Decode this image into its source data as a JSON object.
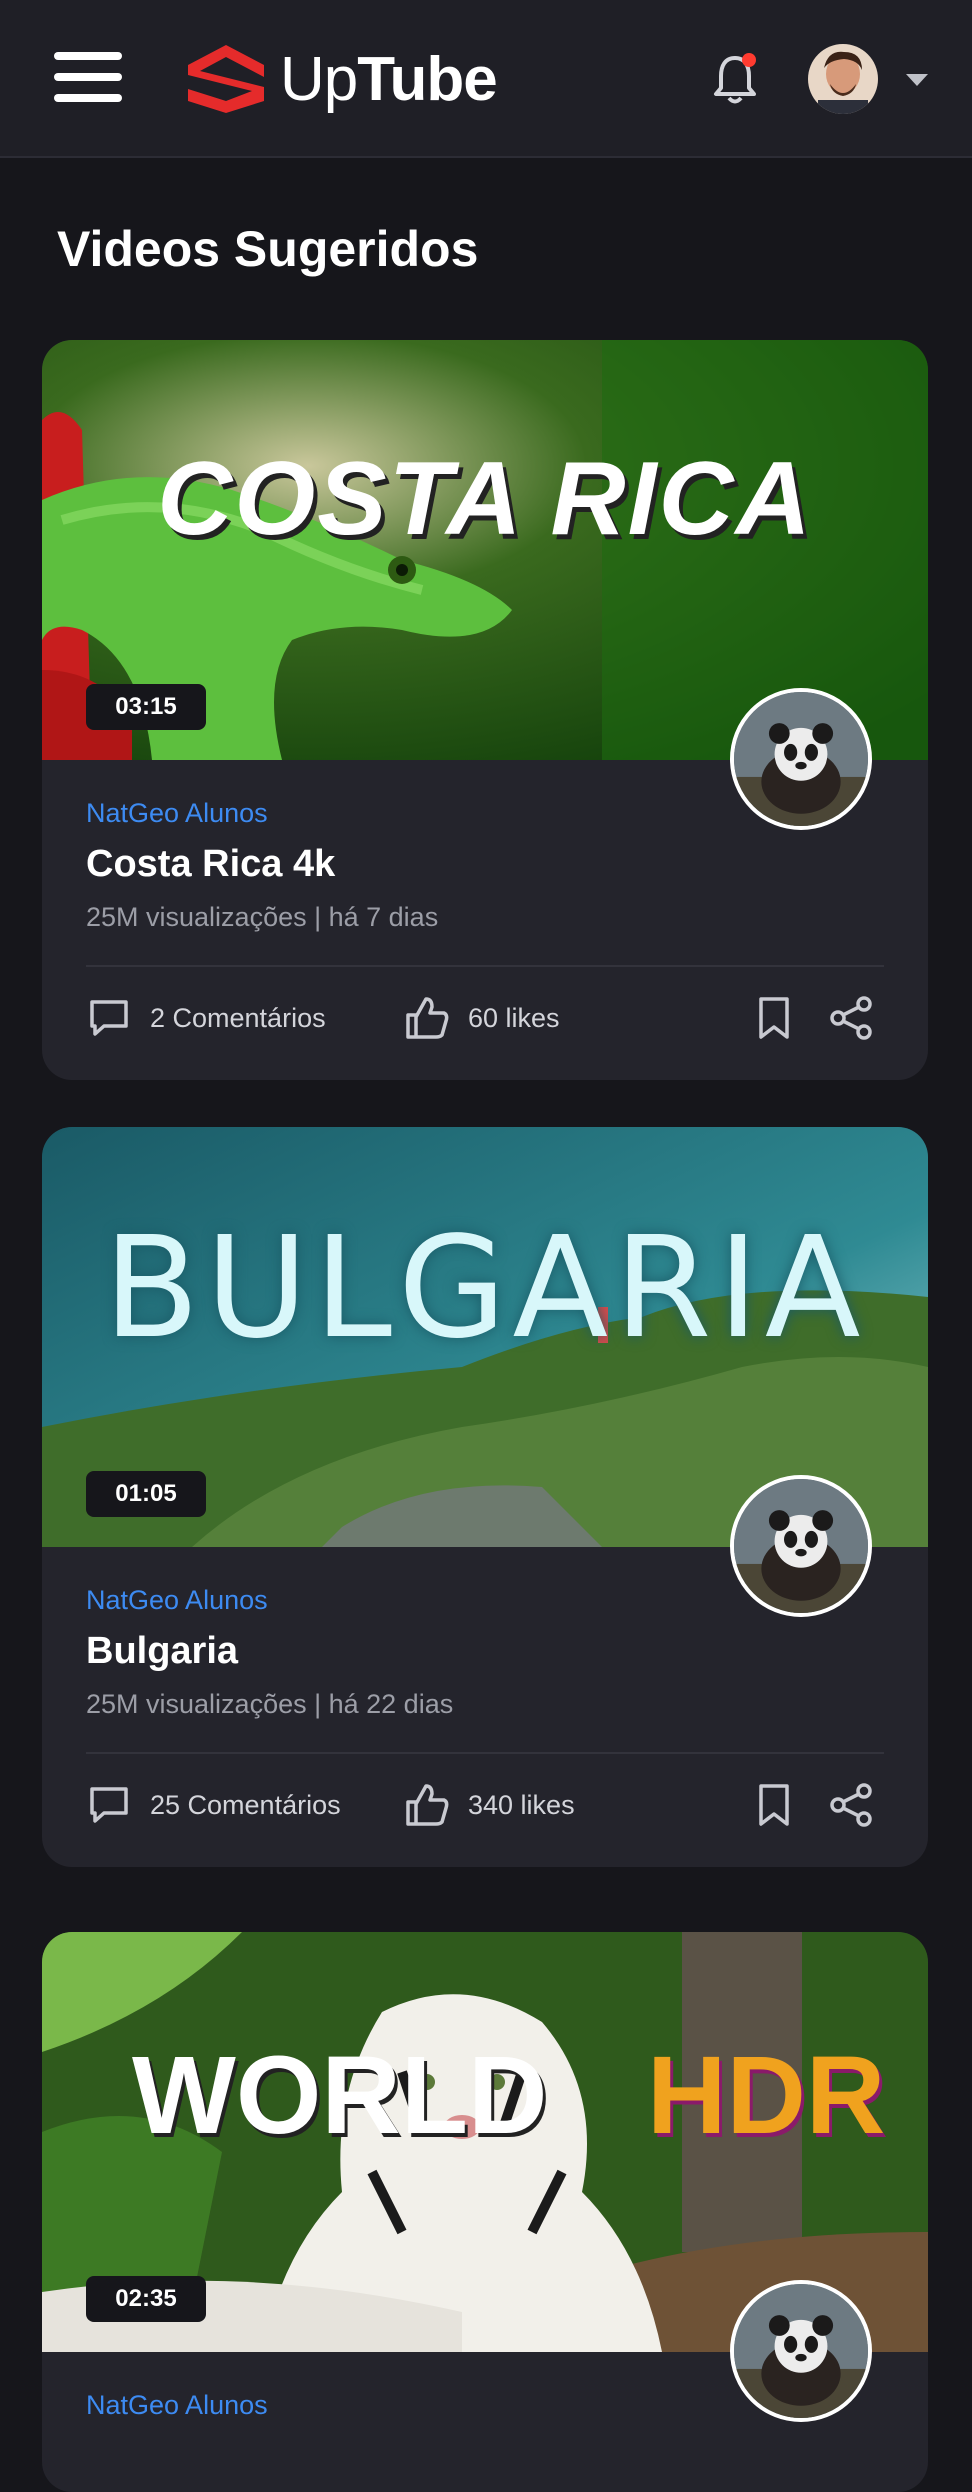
{
  "header": {
    "logo_light": "Up",
    "logo_bold": "Tube",
    "notification_dot_color": "#ff3b30",
    "brand_color": "#e52b2b"
  },
  "page": {
    "title": "Videos Sugeridos"
  },
  "videos": [
    {
      "thumb_text": "COSTA RICA",
      "duration": "03:15",
      "channel": "NatGeo Alunos",
      "title": "Costa Rica 4k",
      "meta": "25M visualizações | há 7 dias",
      "comments": "2 Comentários",
      "likes": "60 likes"
    },
    {
      "thumb_text": "BULGARIA",
      "duration": "01:05",
      "channel": "NatGeo Alunos",
      "title": "Bulgaria",
      "meta": "25M visualizações | há 22 dias",
      "comments": "25 Comentários",
      "likes": "340 likes"
    },
    {
      "thumb_text_a": "WORLD",
      "thumb_text_b": "HDR",
      "duration": "02:35",
      "channel": "NatGeo Alunos"
    }
  ]
}
